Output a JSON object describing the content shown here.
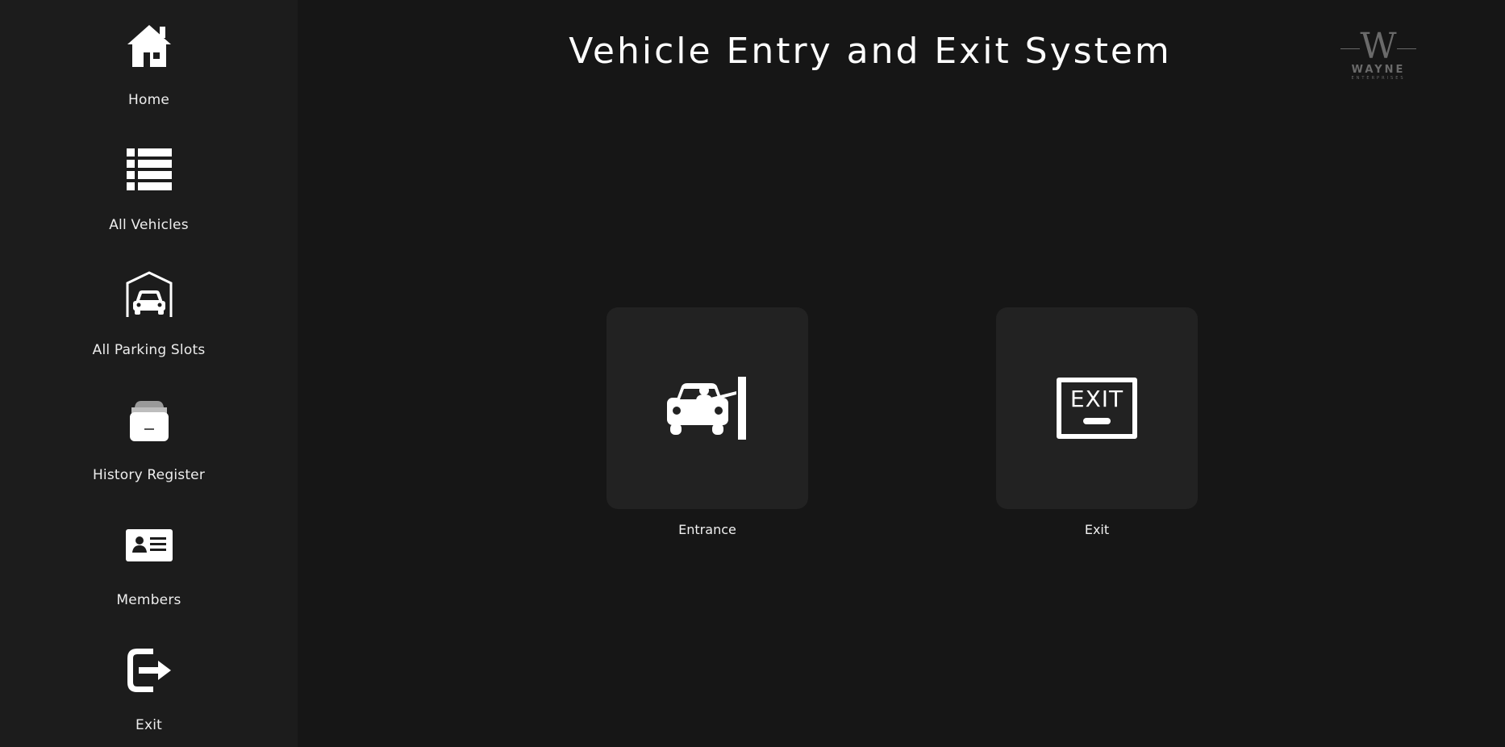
{
  "page": {
    "title": "Vehicle Entry and Exit System"
  },
  "logo": {
    "mark": "W",
    "name": "WAYNE",
    "tagline": "ENTERPRISES"
  },
  "sidebar": {
    "items": [
      {
        "label": "Home",
        "icon": "home-icon"
      },
      {
        "label": "All Vehicles",
        "icon": "list-icon"
      },
      {
        "label": "All Parking Slots",
        "icon": "garage-car-icon"
      },
      {
        "label": "History Register",
        "icon": "archive-box-icon"
      },
      {
        "label": "Members",
        "icon": "id-card-icon"
      },
      {
        "label": "Exit",
        "icon": "logout-icon"
      }
    ]
  },
  "tiles": [
    {
      "label": "Entrance",
      "icon": "car-gate-entrance-icon"
    },
    {
      "label": "Exit",
      "icon": "exit-sign-icon",
      "sign_text": "EXIT"
    }
  ],
  "colors": {
    "background": "#161616",
    "sidebar": "#1c1c1c",
    "tile": "#222222",
    "text": "#ffffff",
    "logo": "#6a6a6a"
  }
}
